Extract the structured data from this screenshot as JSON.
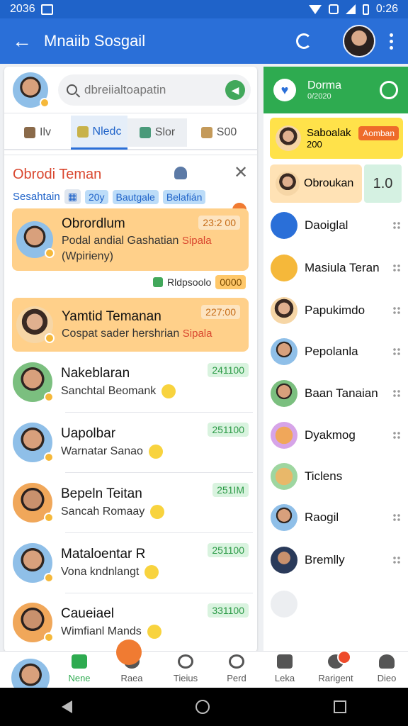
{
  "status_bar": {
    "time_left": "2036",
    "time_right": "0:26"
  },
  "app_bar": {
    "title": "Mnaiib Sosgail"
  },
  "search": {
    "placeholder": "dbreiialtoapatin"
  },
  "tabs": [
    {
      "label": "Ilv"
    },
    {
      "label": "Nledc"
    },
    {
      "label": "Slor"
    },
    {
      "label": "S00"
    }
  ],
  "group": {
    "title": "Obrodi Teman",
    "subtitle": "Sesahtain",
    "chips": [
      "20y",
      "Bautgale",
      "Belafián"
    ]
  },
  "chats": [
    {
      "name": "Obrordlum",
      "message": "Podal andial Gashatian",
      "message2": "(Wpirieny)",
      "tag": "Sipala",
      "time": "23:2 00"
    },
    {
      "name": "Yamtid Temanan",
      "message": "Cospat sader hershrian",
      "tag": "Sipala",
      "time": "227:00"
    },
    {
      "name": "Nakeblaran",
      "message": "Sanchtal Beomank",
      "time": "241100"
    },
    {
      "name": "Uapolbar",
      "message": "Warnatar Sanao",
      "time": "251100"
    },
    {
      "name": "Bepeln Teitan",
      "message": "Sancah Romaay",
      "time": "251IM"
    },
    {
      "name": "Mataloentar R",
      "message": "Vona kndnlangt",
      "time": "251100"
    },
    {
      "name": "Caueiael",
      "message": "Wimfianl Mands",
      "time": "331100"
    }
  ],
  "sub_row": {
    "label": "Rldpsoolo",
    "pill": "0000"
  },
  "right_header": {
    "title": "Dorma",
    "subtitle": "0/2020"
  },
  "right_cards": {
    "yellow": {
      "name": "Saboalak",
      "sub": "200",
      "badge": "Aomban"
    },
    "peach": {
      "name": "Obroukan",
      "value": "1.0"
    }
  },
  "right_list": [
    {
      "name": "Daoiglal",
      "icon": "doctor-avatar-icon",
      "color": "#2a6fd8"
    },
    {
      "name": "Masiula Teran",
      "icon": "hourglass-icon",
      "color": "#f5b83a"
    },
    {
      "name": "Papukimdo",
      "icon": "person-icon",
      "color": "#c9916d"
    },
    {
      "name": "Pepolanla",
      "icon": "person-icon",
      "color": "#8fbfe8"
    },
    {
      "name": "Baan Tanaian",
      "icon": "person-icon",
      "color": "#7bbf7f"
    },
    {
      "name": "Dyakmog",
      "icon": "cartoon-icon",
      "color": "#d6a4e8"
    },
    {
      "name": "Ticlens",
      "icon": "cartoon-icon",
      "color": "#9ed6a0"
    },
    {
      "name": "Raogil",
      "icon": "person-icon",
      "color": "#8fbfe8"
    },
    {
      "name": "Bremlly",
      "icon": "person-icon",
      "color": "#2a3a5a"
    }
  ],
  "bottom_nav": [
    {
      "label": "Nene",
      "active": true
    },
    {
      "label": "Raea"
    },
    {
      "label": "Tieius"
    },
    {
      "label": "Perd"
    },
    {
      "label": "Leka"
    },
    {
      "label": "Rarigent"
    },
    {
      "label": "Dieo"
    }
  ]
}
